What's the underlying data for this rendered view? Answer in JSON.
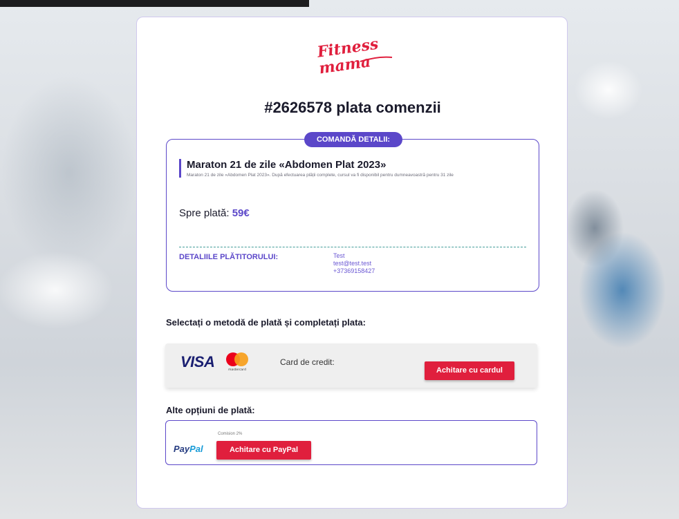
{
  "order": {
    "title": "#2626578 plata comenzii",
    "details_label": "COMANDĂ DETALII:",
    "product_name": "Maraton 21 de zile «Abdomen Plat 2023»",
    "product_desc": "Maraton 21 de zile «Abdomen Plat 2023». După efectuarea plății complete, cursul va fi disponibil pentru dumneavoastră pentru 31 zile",
    "amount_label": "Spre plată:",
    "amount_value": "59€",
    "payer_label": "DETALIILE PLĂTITORULUI:",
    "payer_name": "Test",
    "payer_email": "test@test.test",
    "payer_phone": "+37369158427"
  },
  "payment": {
    "select_title": "Selectați o metodă de plată și completați plata:",
    "visa_text": "VISA",
    "mastercard_text": "mastercard",
    "card_label": "Card de credit:",
    "card_button": "Achitare cu cardul",
    "alt_title": "Alte opțiuni de plată:",
    "paypal_pay": "Pay",
    "paypal_pal": "Pal",
    "commission": "Comision 2%",
    "paypal_button": "Achitare cu PayPal"
  },
  "brand": {
    "logo_line1": "Fitness",
    "logo_line2": "mama",
    "accent": "#5b47c9",
    "cta": "#e01f3d"
  }
}
